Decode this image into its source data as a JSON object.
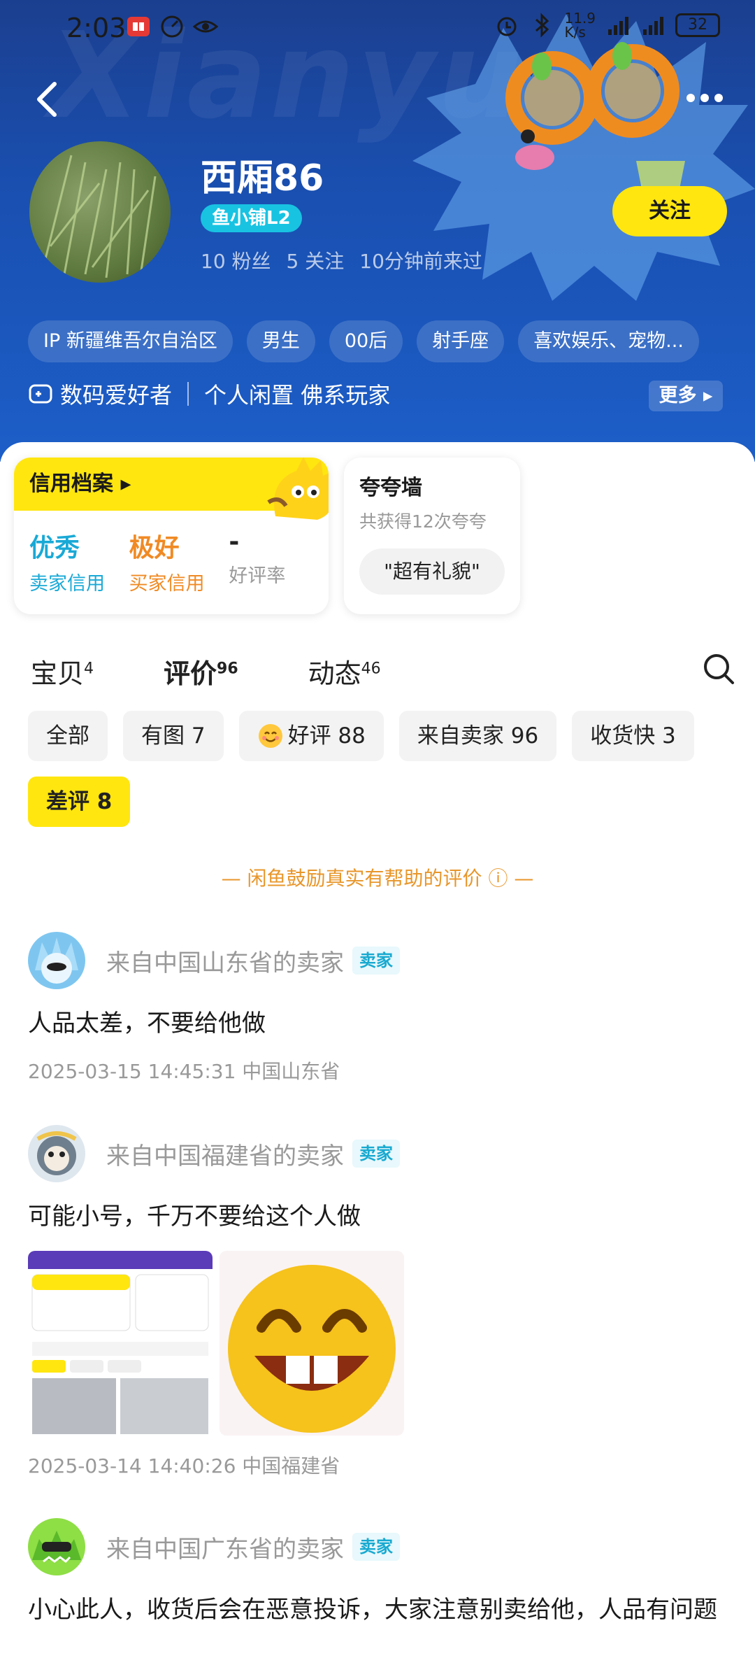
{
  "status_bar": {
    "time": "2:03",
    "net_speed": "11.9\nK/s",
    "battery": "32"
  },
  "header": {
    "bg_word": "Xianyu",
    "user_name": "西厢86",
    "shop_level": "鱼小铺L2",
    "fans": "10 粉丝",
    "following": "5 关注",
    "last_seen": "10分钟前来过",
    "follow_label": "关注",
    "tags": [
      "IP 新疆维吾尔自治区",
      "男生",
      "00后",
      "射手座",
      "喜欢娱乐、宠物..."
    ],
    "hobbies": [
      "数码爱好者",
      "个人闲置 佛系玩家"
    ],
    "more_label": "更多"
  },
  "credit": {
    "title": "信用档案",
    "seller_value": "优秀",
    "seller_label": "卖家信用",
    "buyer_value": "极好",
    "buyer_label": "买家信用",
    "rate_value": "-",
    "rate_label": "好评率"
  },
  "kuakua": {
    "title": "夸夸墙",
    "subtitle": "共获得12次夸夸",
    "chip": "\"超有礼貌\""
  },
  "tabs": [
    {
      "label": "宝贝",
      "count": "4"
    },
    {
      "label": "评价",
      "count": "96"
    },
    {
      "label": "动态",
      "count": "46"
    }
  ],
  "filters": [
    "全部",
    "有图 7",
    "好评 88",
    "来自卖家 96",
    "收货快 3",
    "差评 8"
  ],
  "encourage": "— 闲鱼鼓励真实有帮助的评价 ⓘ —",
  "reviews": [
    {
      "name": "来自中国山东省的卖家",
      "badge": "卖家",
      "text": "人品太差，不要给他做",
      "meta": "2025-03-15 14:45:31  中国山东省"
    },
    {
      "name": "来自中国福建省的卖家",
      "badge": "卖家",
      "text": "可能小号，千万不要给这个人做",
      "meta": "2025-03-14 14:40:26  中国福建省"
    },
    {
      "name": "来自中国广东省的卖家",
      "badge": "卖家",
      "text": "小心此人，收货后会在恶意投诉，大家注意别卖给他，人品有问题"
    }
  ],
  "colors": {
    "accent_yellow": "#ffe60f",
    "header_blue": "#1a4fb0",
    "seller_credit": "#19a9d6",
    "buyer_credit": "#f08a24"
  }
}
